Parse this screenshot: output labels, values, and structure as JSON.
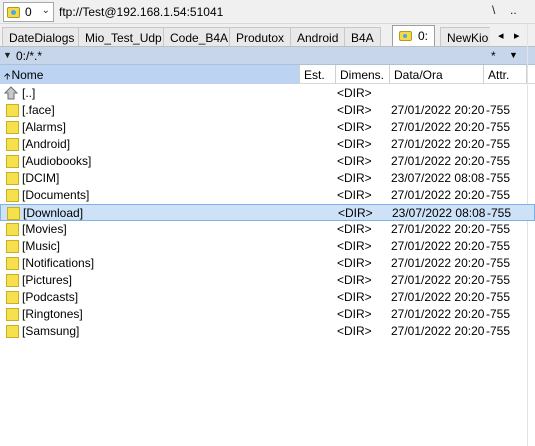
{
  "pathbar": {
    "drive_label": "0",
    "path": "ftp://Test@192.168.1.54:51041",
    "root_button": "\\",
    "parent_button": ".."
  },
  "tabs": [
    {
      "label": "DateDialogs"
    },
    {
      "label": "Mio_Test_Udp"
    },
    {
      "label": "Code_B4A"
    },
    {
      "label": "Produtox"
    },
    {
      "label": "Android"
    },
    {
      "label": "B4A"
    },
    {
      "label": "0:",
      "active": true
    },
    {
      "label": "NewKio"
    }
  ],
  "tab_scroll": {
    "left": "◂",
    "right": "▸"
  },
  "dirbar": {
    "path": "0:/*.*",
    "filter": "*"
  },
  "columns": {
    "name": "Nome",
    "ext": "Est.",
    "size": "Dimens.",
    "date": "Data/Ora",
    "attr": "Attr."
  },
  "files": [
    {
      "name": "[..]",
      "size": "<DIR>",
      "date": "",
      "attr": "",
      "icon": "up-dir-icon"
    },
    {
      "name": "[.face]",
      "size": "<DIR>",
      "date": "27/01/2022 20:20",
      "attr": "-755",
      "icon": "folder-icon"
    },
    {
      "name": "[Alarms]",
      "size": "<DIR>",
      "date": "27/01/2022 20:20",
      "attr": "-755",
      "icon": "folder-icon"
    },
    {
      "name": "[Android]",
      "size": "<DIR>",
      "date": "27/01/2022 20:20",
      "attr": "-755",
      "icon": "folder-icon"
    },
    {
      "name": "[Audiobooks]",
      "size": "<DIR>",
      "date": "27/01/2022 20:20",
      "attr": "-755",
      "icon": "folder-icon"
    },
    {
      "name": "[DCIM]",
      "size": "<DIR>",
      "date": "23/07/2022 08:08",
      "attr": "-755",
      "icon": "folder-icon"
    },
    {
      "name": "[Documents]",
      "size": "<DIR>",
      "date": "27/01/2022 20:20",
      "attr": "-755",
      "icon": "folder-icon"
    },
    {
      "name": "[Download]",
      "size": "<DIR>",
      "date": "23/07/2022 08:08",
      "attr": "-755",
      "icon": "folder-icon",
      "selected": true
    },
    {
      "name": "[Movies]",
      "size": "<DIR>",
      "date": "27/01/2022 20:20",
      "attr": "-755",
      "icon": "folder-icon"
    },
    {
      "name": "[Music]",
      "size": "<DIR>",
      "date": "27/01/2022 20:20",
      "attr": "-755",
      "icon": "folder-icon"
    },
    {
      "name": "[Notifications]",
      "size": "<DIR>",
      "date": "27/01/2022 20:20",
      "attr": "-755",
      "icon": "folder-icon"
    },
    {
      "name": "[Pictures]",
      "size": "<DIR>",
      "date": "27/01/2022 20:20",
      "attr": "-755",
      "icon": "folder-icon"
    },
    {
      "name": "[Podcasts]",
      "size": "<DIR>",
      "date": "27/01/2022 20:20",
      "attr": "-755",
      "icon": "folder-icon"
    },
    {
      "name": "[Ringtones]",
      "size": "<DIR>",
      "date": "27/01/2022 20:20",
      "attr": "-755",
      "icon": "folder-icon"
    },
    {
      "name": "[Samsung]",
      "size": "<DIR>",
      "date": "27/01/2022 20:20",
      "attr": "-755",
      "icon": "folder-icon"
    }
  ],
  "colors": {
    "folder": "#f6e04c",
    "selected_row": "#cde1f7",
    "sorted_column": "#bcd4f2",
    "dirbar": "#c7d6ea"
  }
}
